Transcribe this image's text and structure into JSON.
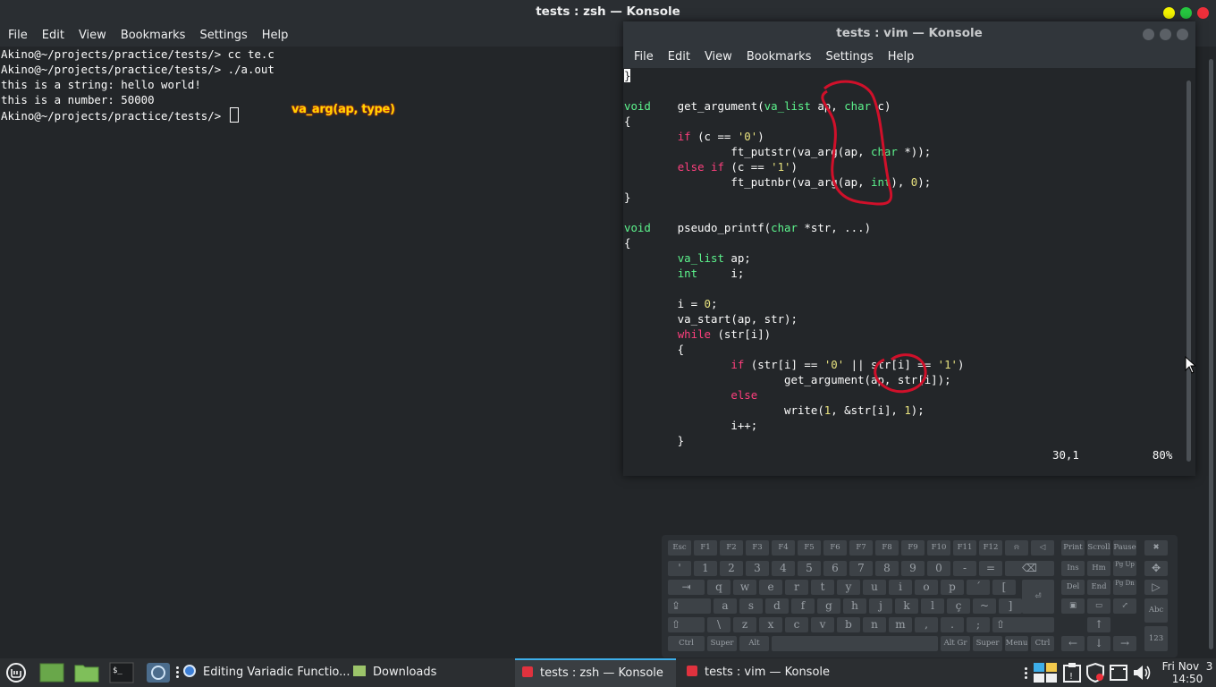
{
  "main_window": {
    "title": "tests : zsh — Konsole",
    "menu": [
      "File",
      "Edit",
      "View",
      "Bookmarks",
      "Settings",
      "Help"
    ],
    "lines": [
      "Akino@~/projects/practice/tests/> cc te.c",
      "Akino@~/projects/practice/tests/> ./a.out",
      "this is a string: hello world!",
      "this is a number: 50000",
      "Akino@~/projects/practice/tests/> "
    ],
    "annotation": "va_arg(ap, type)",
    "button_colors": {
      "minimize": "#f4f400",
      "maximize": "#26c740",
      "close": "#ed2f3a"
    }
  },
  "vim_window": {
    "title": "tests : vim — Konsole",
    "menu": [
      "File",
      "Edit",
      "View",
      "Bookmarks",
      "Settings",
      "Help"
    ],
    "code": [
      "}",
      "",
      "void    get_argument(va_list ap, char c)",
      "{",
      "        if (c == '0')",
      "                ft_putstr(va_arg(ap, char *));",
      "        else if (c == '1')",
      "                ft_putnbr(va_arg(ap, int), 0);",
      "}",
      "",
      "void    pseudo_printf(char *str, ...)",
      "{",
      "        va_list ap;",
      "        int     i;",
      "",
      "        i = 0;",
      "        va_start(ap, str);",
      "        while (str[i])",
      "        {",
      "                if (str[i] == '0' || str[i] == '1')",
      "                        get_argument(ap, str[i]);",
      "                else",
      "                        write(1, &str[i], 1);",
      "                i++;",
      "        }"
    ],
    "status_position": "30,1",
    "status_percent": "80%"
  },
  "keyboard": {
    "row1": [
      "Esc",
      "F1",
      "F2",
      "F3",
      "F4",
      "F5",
      "F6",
      "F7",
      "F8",
      "F9",
      "F10",
      "F11",
      "F12"
    ],
    "row2": [
      "'",
      "1",
      "2",
      "3",
      "4",
      "5",
      "6",
      "7",
      "8",
      "9",
      "0",
      "-",
      "="
    ],
    "row3": [
      "q",
      "w",
      "e",
      "r",
      "t",
      "y",
      "u",
      "i",
      "o",
      "p",
      "´",
      "["
    ],
    "row4": [
      "a",
      "s",
      "d",
      "f",
      "g",
      "h",
      "j",
      "k",
      "l",
      "ç",
      "~",
      "]"
    ],
    "row5": [
      "\\",
      "z",
      "x",
      "c",
      "v",
      "b",
      "n",
      "m",
      ",",
      ".",
      ";"
    ],
    "bottom": [
      "Ctrl",
      "Super",
      "Alt",
      "Alt Gr",
      "Super",
      "Menu",
      "Ctrl"
    ],
    "nav": [
      "Print",
      "Scroll",
      "Pause",
      "Ins",
      "Hm",
      "Pg Up",
      "Del",
      "End",
      "Pg Dn"
    ],
    "arrows": [
      "↑",
      "←",
      "↓",
      "→"
    ],
    "side": [
      "Abc",
      "123"
    ]
  },
  "taskbar": {
    "tasks": [
      "Editing Variadic Functio...",
      "Downloads",
      "tests : zsh — Konsole",
      "tests : vim — Konsole"
    ],
    "clock_day": "Fri Nov  3",
    "clock_time": "14:50"
  }
}
